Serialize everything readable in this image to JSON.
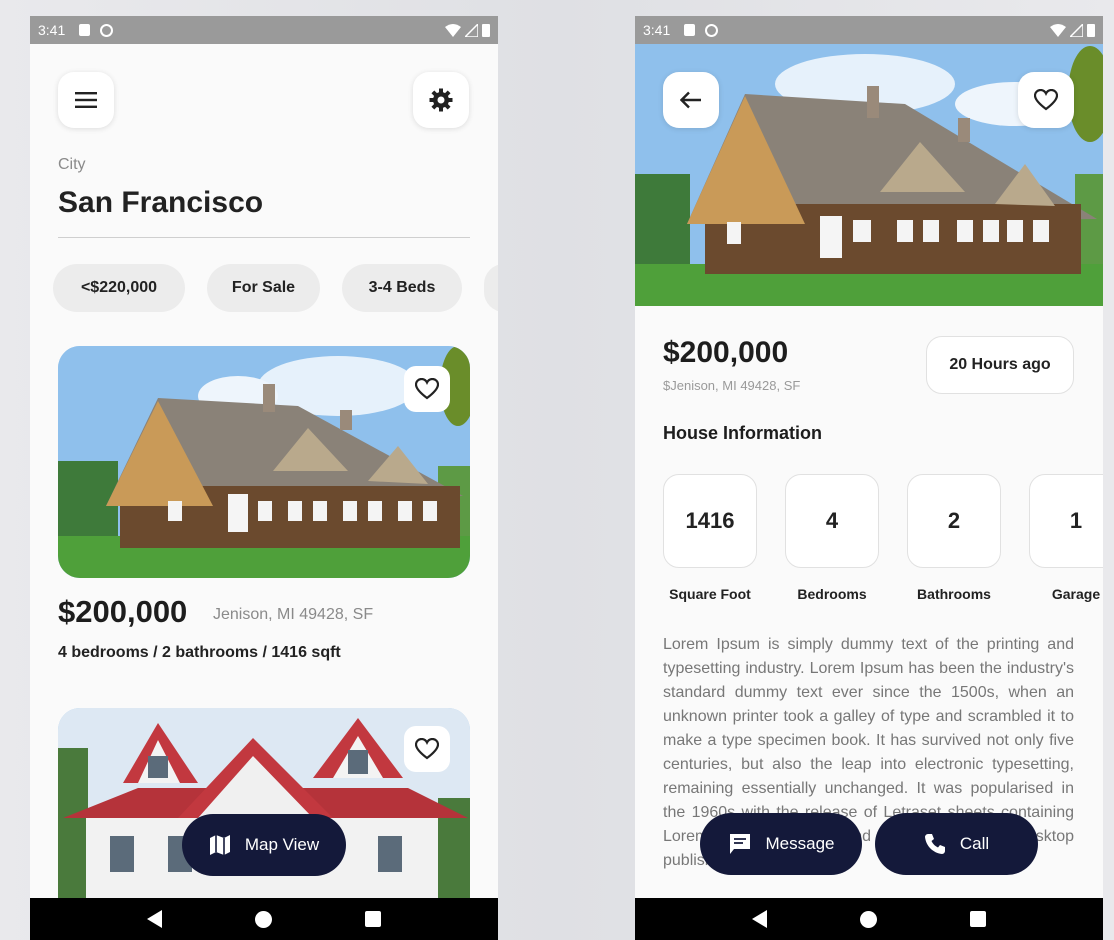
{
  "status_bar": {
    "time": "3:41"
  },
  "list_screen": {
    "city_label": "City",
    "city_name": "San Francisco",
    "filters": [
      "<$220,000",
      "For Sale",
      "3-4 Beds"
    ],
    "listing": {
      "price": "$200,000",
      "address": "Jenison, MI 49428, SF",
      "specs": "4 bedrooms / 2 bathrooms / 1416 sqft"
    },
    "map_button_label": "Map View"
  },
  "detail_screen": {
    "price": "$200,000",
    "address": "$Jenison, MI 49428, SF",
    "posted": "20 Hours ago",
    "section_title": "House Information",
    "info": [
      {
        "value": "1416",
        "label": "Square Foot"
      },
      {
        "value": "4",
        "label": "Bedrooms"
      },
      {
        "value": "2",
        "label": "Bathrooms"
      },
      {
        "value": "1",
        "label": "Garage"
      }
    ],
    "description": "Lorem Ipsum is simply dummy text of the printing and typesetting industry. Lorem Ipsum has been the industry's standard dummy text ever since the 1500s, when an unknown printer took a galley of type and scrambled it to make a type specimen book. It has survived not only five centuries, but also the leap into electronic typesetting, remaining essentially unchanged. It was popularised in the 1960s with the release of Letraset sheets containing Lorem Ipsum passages, and more recently with desktop publishing",
    "message_label": "Message",
    "call_label": "Call"
  },
  "icons": {
    "menu": "hamburger-menu-icon",
    "settings": "gear-icon",
    "favorite": "heart-outline-icon",
    "back": "arrow-left-icon",
    "map": "map-icon",
    "message": "chat-bubble-icon",
    "call": "phone-icon"
  },
  "colors": {
    "accent": "#14193a",
    "background": "#fafafa",
    "chip": "#ececec"
  }
}
